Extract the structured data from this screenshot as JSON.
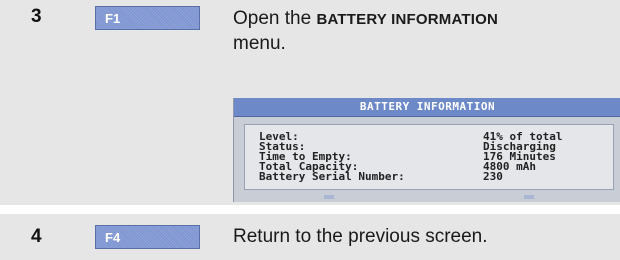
{
  "steps": [
    {
      "number": "3",
      "key_label": "F1",
      "instruction_prefix": "Open the ",
      "instruction_caps": "BATTERY INFORMATION",
      "instruction_suffix": " menu."
    },
    {
      "number": "4",
      "key_label": "F4",
      "instruction": "Return to the previous screen."
    }
  ],
  "screen": {
    "title": "BATTERY INFORMATION",
    "rows": [
      {
        "label": "Level:",
        "value": "41% of total"
      },
      {
        "label": "Status:",
        "value": "Discharging"
      },
      {
        "label": "Time to Empty:",
        "value": "176 Minutes"
      },
      {
        "label": "Total Capacity:",
        "value": "4800 mAh"
      },
      {
        "label": "Battery Serial Number:",
        "value": "230"
      }
    ]
  },
  "colors": {
    "row_background": "#e6e6e6",
    "key_button": "#7d93cf",
    "screen_header": "#6d89c7"
  }
}
